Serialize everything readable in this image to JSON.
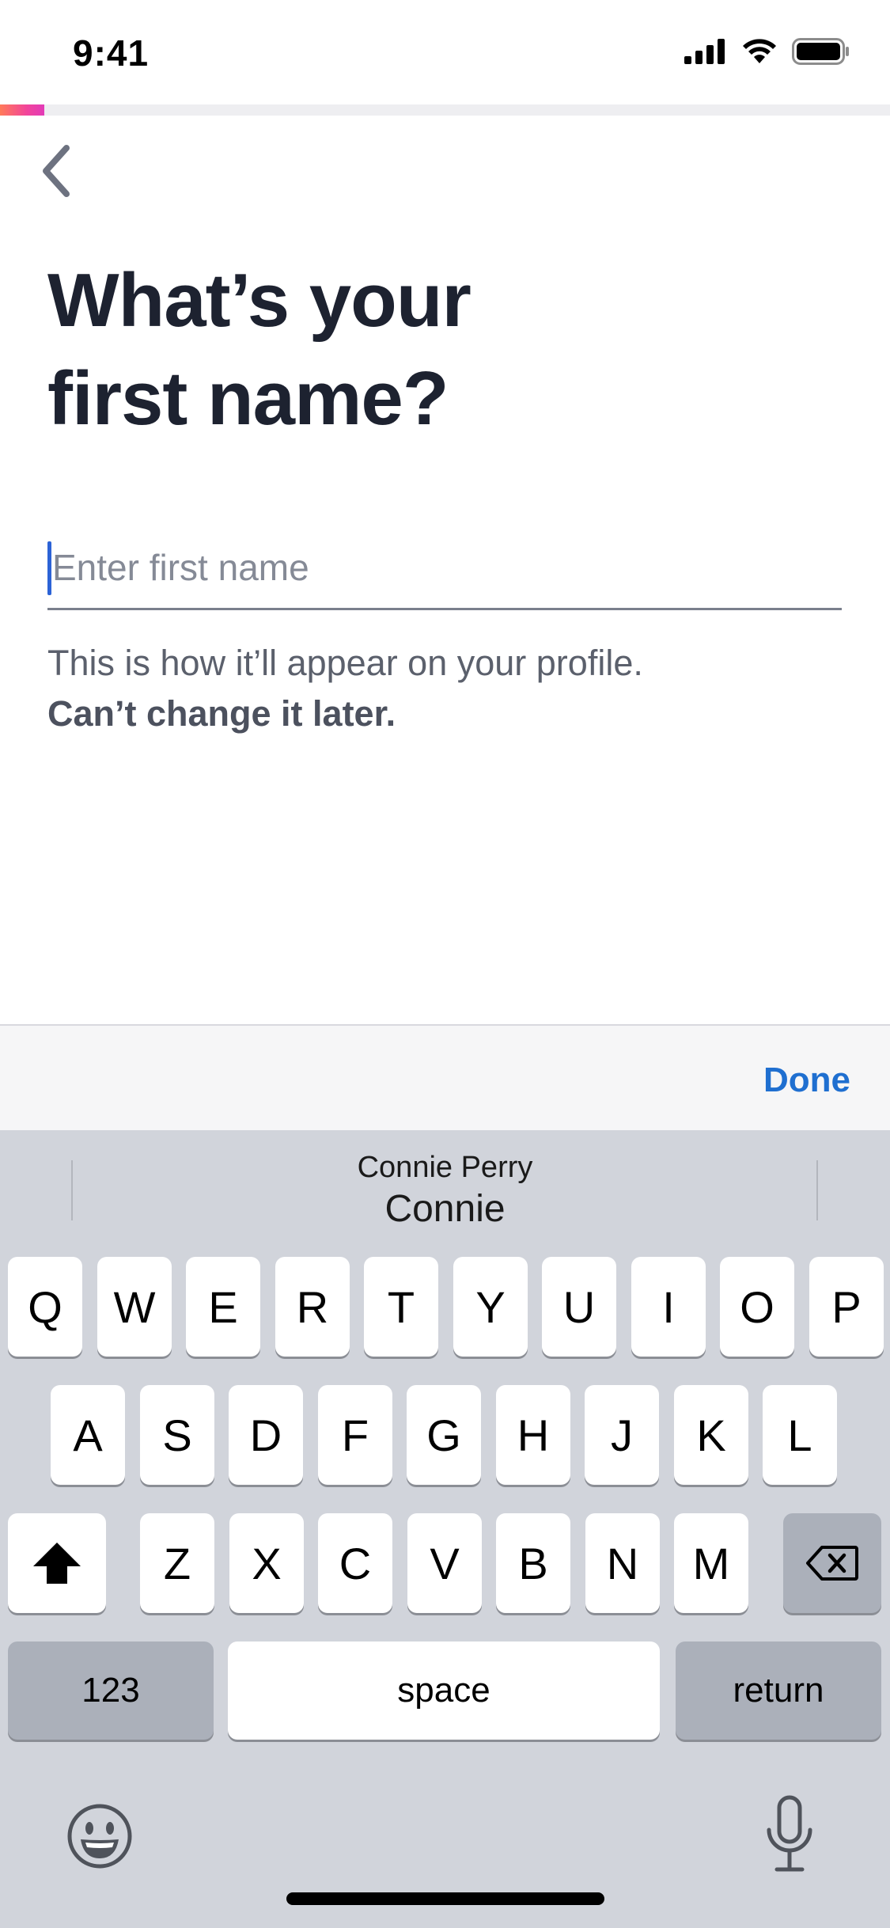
{
  "status_bar": {
    "time": "9:41",
    "icons": [
      "signal-icon",
      "wifi-icon",
      "battery-icon"
    ]
  },
  "progress": {
    "fraction": 0.05
  },
  "header": {
    "back_icon": "chevron-left-icon"
  },
  "title_lines": [
    "What’s your",
    "first name?"
  ],
  "name_field": {
    "placeholder": "Enter first name",
    "value": ""
  },
  "helper": {
    "text": "This is how it’ll appear on your profile.",
    "strong": "Can’t change it later."
  },
  "accessory": {
    "done_label": "Done"
  },
  "keyboard": {
    "suggestion_primary": "Connie Perry",
    "suggestion_secondary": "Connie",
    "row1": [
      "Q",
      "W",
      "E",
      "R",
      "T",
      "Y",
      "U",
      "I",
      "O",
      "P"
    ],
    "row2": [
      "A",
      "S",
      "D",
      "F",
      "G",
      "H",
      "J",
      "K",
      "L"
    ],
    "row3": [
      "Z",
      "X",
      "C",
      "V",
      "B",
      "N",
      "M"
    ],
    "numbers_label": "123",
    "space_label": "space",
    "return_label": "return"
  },
  "colors": {
    "accent": "#1f6fd0",
    "progress_start": "#ff7a59",
    "progress_end": "#e23bb8"
  }
}
